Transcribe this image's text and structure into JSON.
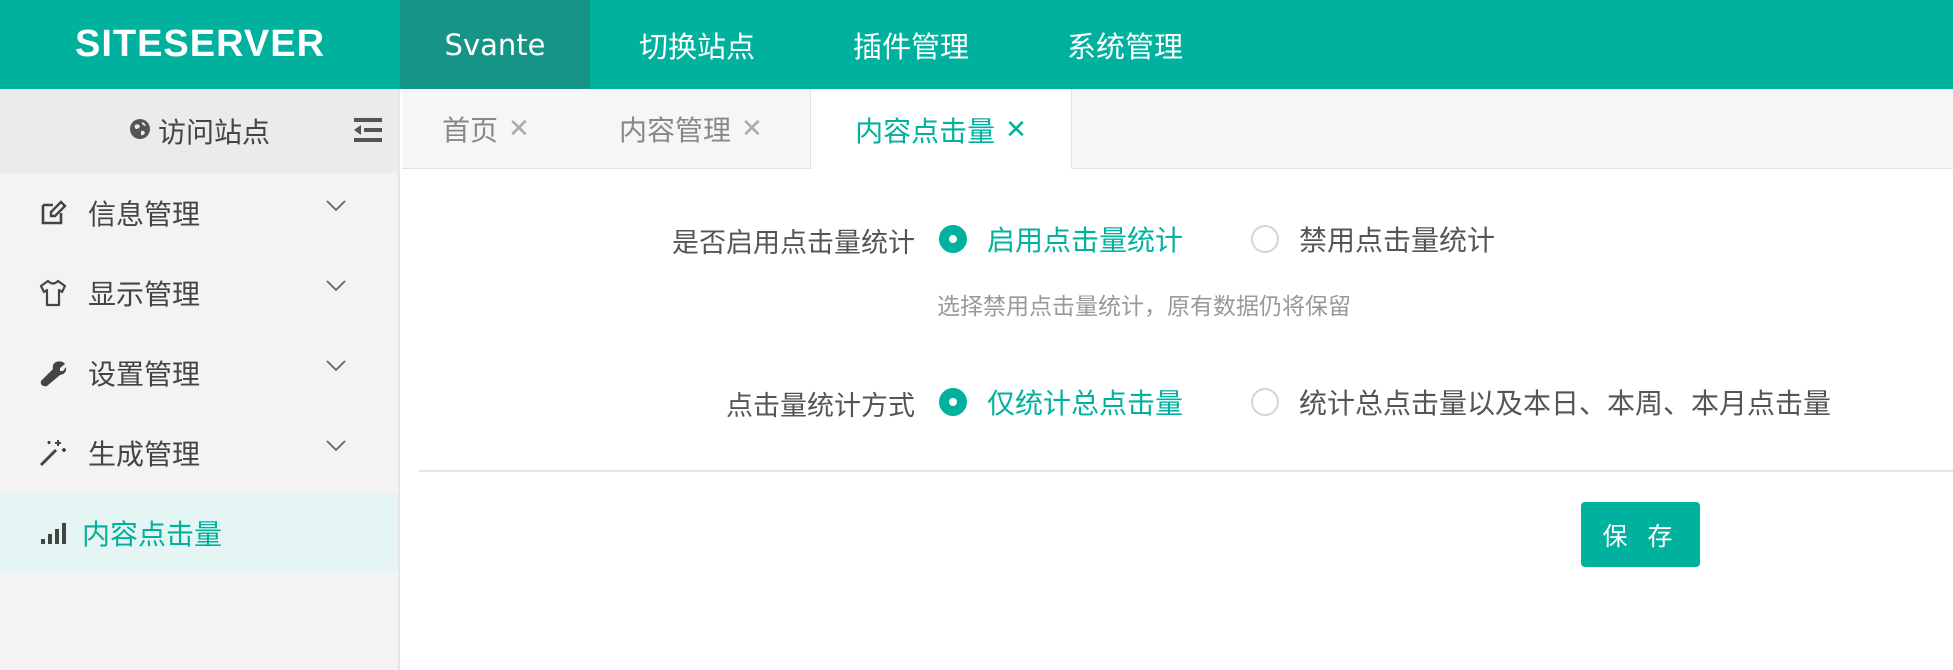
{
  "header": {
    "logo_text": "SITESERVER",
    "nav": [
      {
        "label": "Svante"
      },
      {
        "label": "切换站点"
      },
      {
        "label": "插件管理"
      },
      {
        "label": "系统管理"
      }
    ]
  },
  "sidebar": {
    "visit_site": "访问站点",
    "items": [
      {
        "label": "信息管理",
        "icon": "edit-icon"
      },
      {
        "label": "显示管理",
        "icon": "shirt-icon"
      },
      {
        "label": "设置管理",
        "icon": "wrench-icon"
      },
      {
        "label": "生成管理",
        "icon": "magic-wand-icon"
      },
      {
        "label": "内容点击量",
        "icon": "bar-chart-icon"
      }
    ]
  },
  "tabs": [
    {
      "label": "首页"
    },
    {
      "label": "内容管理"
    },
    {
      "label": "内容点击量"
    }
  ],
  "form": {
    "enable": {
      "label": "是否启用点击量统计",
      "options": [
        "启用点击量统计",
        "禁用点击量统计"
      ],
      "selected": "启用点击量统计",
      "hint": "选择禁用点击量统计，原有数据仍将保留"
    },
    "method": {
      "label": "点击量统计方式",
      "options": [
        "仅统计总点击量",
        "统计总点击量以及本日、本周、本月点击量"
      ],
      "selected": "仅统计总点击量"
    },
    "save_label": "保 存"
  },
  "colors": {
    "accent": "#00b19d",
    "sidebar_bg": "#f3f3f4",
    "active_item_bg": "#e5f5f3"
  }
}
